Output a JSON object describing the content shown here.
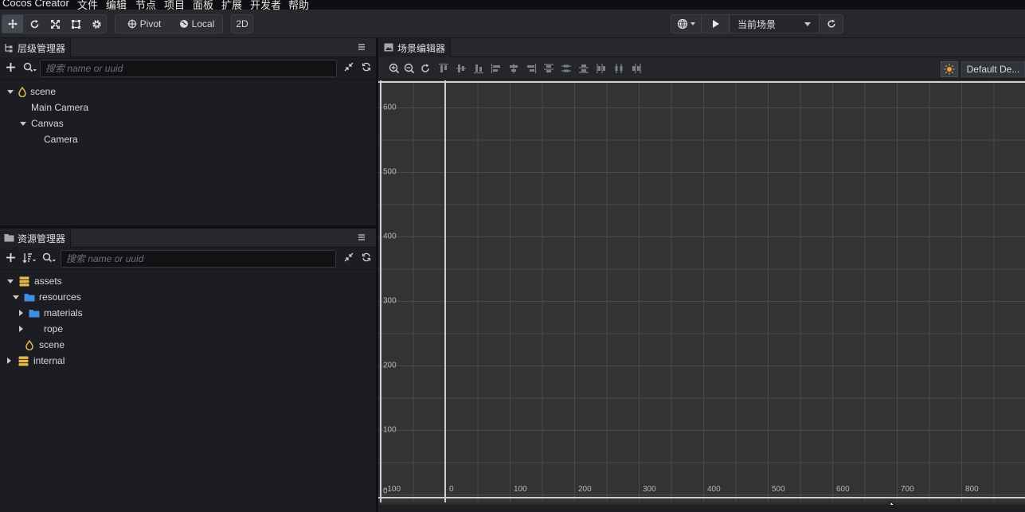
{
  "menubar": {
    "app_title": "Cocos Creator",
    "items": [
      "文件",
      "编辑",
      "节点",
      "项目",
      "面板",
      "扩展",
      "开发者",
      "帮助"
    ]
  },
  "toolbar": {
    "pivot_label": "Pivot",
    "local_label": "Local",
    "mode_2d_label": "2D",
    "scene_select_value": "当前场景"
  },
  "hierarchy": {
    "title": "层级管理器",
    "search_placeholder": "搜索 name or uuid",
    "nodes": [
      {
        "label": "scene",
        "expanded": true
      },
      {
        "label": "Main Camera"
      },
      {
        "label": "Canvas",
        "expanded": true
      },
      {
        "label": "Camera"
      }
    ]
  },
  "assets": {
    "title": "资源管理器",
    "search_placeholder": "搜索 name or uuid",
    "items": [
      {
        "label": "assets",
        "expanded": true,
        "icon": "database-icon"
      },
      {
        "label": "resources",
        "expanded": true,
        "icon": "folder-icon"
      },
      {
        "label": "materials",
        "expanded": false,
        "icon": "folder-icon"
      },
      {
        "label": "rope",
        "expanded": false
      },
      {
        "label": "scene",
        "icon": "scene-icon"
      },
      {
        "label": "internal",
        "expanded": false,
        "icon": "database-icon"
      }
    ]
  },
  "scene_editor": {
    "title": "场景编辑器",
    "layout_button": "Default De...",
    "y_ticks": [
      "600",
      "500",
      "400",
      "300",
      "200",
      "100",
      "0"
    ],
    "x_ticks": [
      "-100",
      "0",
      "100",
      "200",
      "300",
      "400",
      "500",
      "600",
      "700",
      "800"
    ]
  },
  "colors": {
    "accent_yellow": "#e8b84a",
    "folder_blue": "#3d8fe0",
    "canvas_bg": "#333333",
    "grid_line": "#4a4a4a",
    "frame_line": "#cfcfcf"
  }
}
